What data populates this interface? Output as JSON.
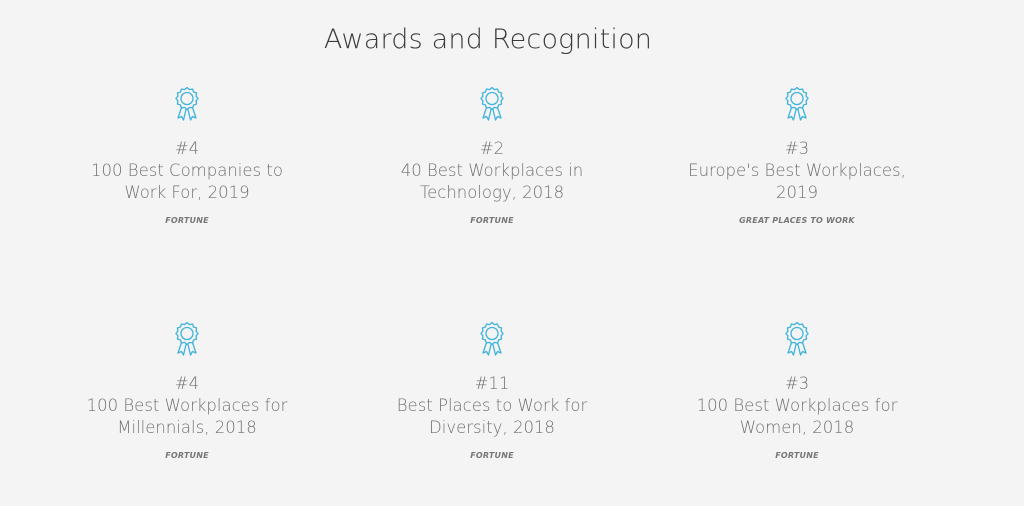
{
  "section": {
    "title": "Awards and Recognition",
    "accent_color": "#3fb3dc"
  },
  "awards": [
    {
      "icon": "award-ribbon-icon",
      "rank": "#4",
      "name": "100 Best Companies to\nWork For, 2019",
      "source": "FORTUNE"
    },
    {
      "icon": "award-ribbon-icon",
      "rank": "#2",
      "name": "40 Best Workplaces in\nTechnology, 2018",
      "source": "FORTUNE"
    },
    {
      "icon": "award-ribbon-icon",
      "rank": "#3",
      "name": "Europe's Best Workplaces,\n2019",
      "source": "GREAT PLACES TO WORK"
    },
    {
      "icon": "award-ribbon-icon",
      "rank": "#4",
      "name": "100 Best Workplaces for\nMillennials, 2018",
      "source": "FORTUNE"
    },
    {
      "icon": "award-ribbon-icon",
      "rank": "#11",
      "name": "Best Places to Work for\nDiversity, 2018",
      "source": "FORTUNE"
    },
    {
      "icon": "award-ribbon-icon",
      "rank": "#3",
      "name": "100 Best Workplaces for\nWomen, 2018",
      "source": "FORTUNE"
    }
  ]
}
